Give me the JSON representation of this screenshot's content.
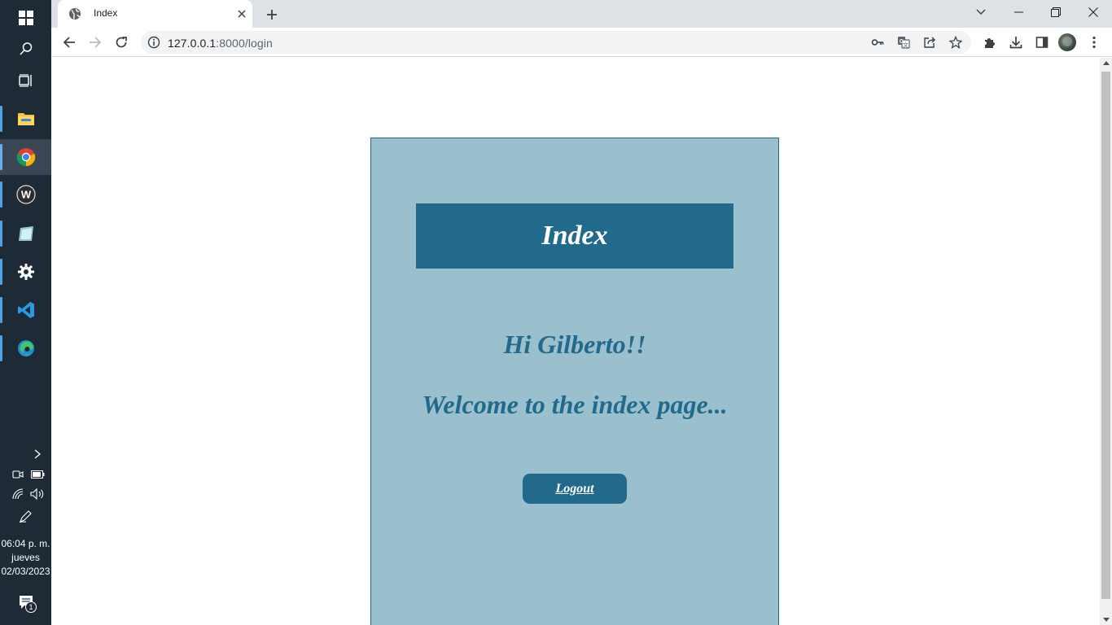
{
  "taskbar": {
    "apps": [
      {
        "name": "file-explorer"
      },
      {
        "name": "google-chrome"
      },
      {
        "name": "wamp"
      },
      {
        "name": "notes-app"
      },
      {
        "name": "settings"
      },
      {
        "name": "vscode"
      },
      {
        "name": "edge"
      }
    ],
    "clock": {
      "time": "06:04 p. m.",
      "day": "jueves",
      "date": "02/03/2023"
    },
    "notification_count": "1"
  },
  "browser": {
    "tab_title": "Index",
    "url_host": "127.0.0.1",
    "url_path": ":8000/login"
  },
  "page": {
    "header_title": "Index",
    "greeting": "Hi Gilberto!!",
    "welcome": "Welcome to the index page...",
    "logout_label": "Logout",
    "colors": {
      "card_bg": "#9abfcd",
      "accent": "#226a8b",
      "text_light": "#ffffff"
    }
  }
}
